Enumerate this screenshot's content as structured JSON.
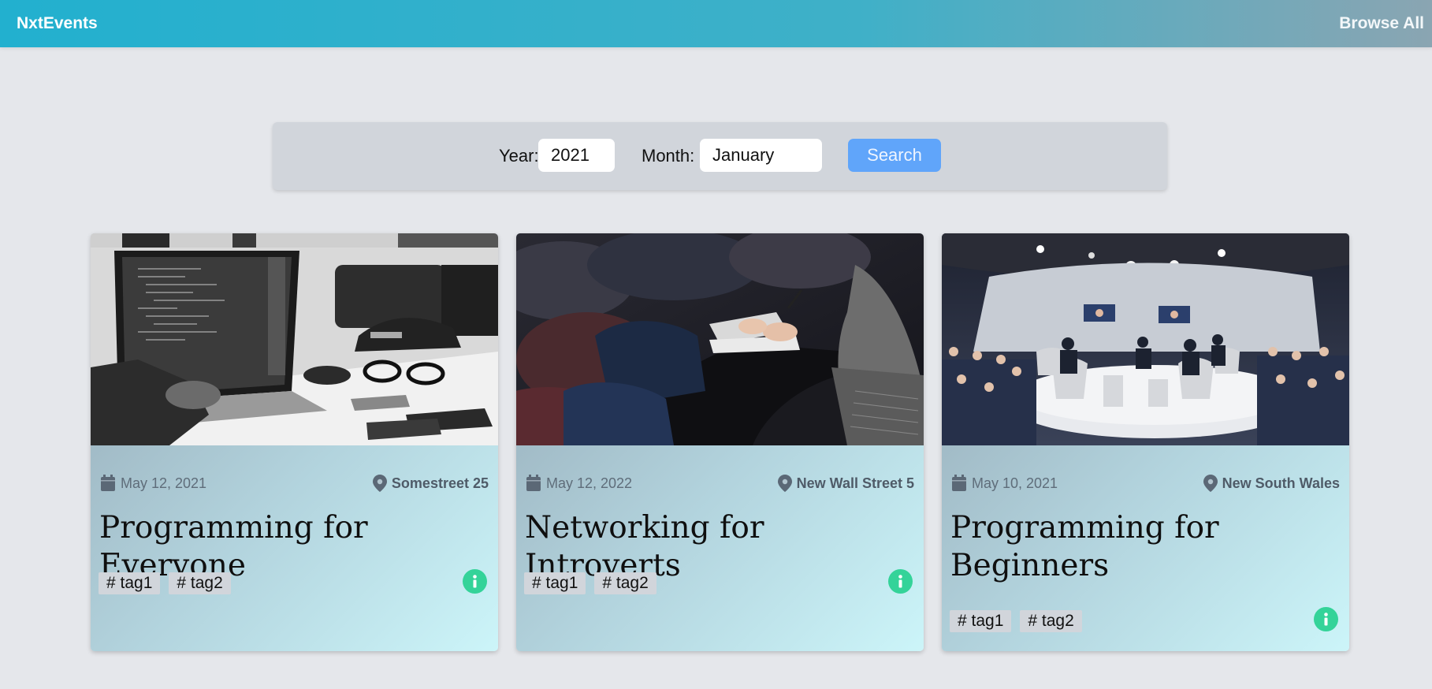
{
  "nav": {
    "brand": "NxtEvents",
    "browse_all": "Browse All"
  },
  "search": {
    "year_label": "Year:",
    "year_value": "2021",
    "month_label": "Month:",
    "month_value": "January",
    "button_label": "Search"
  },
  "colors": {
    "accent": "#60a5fa",
    "info": "#34d399",
    "header_start": "#22b0cf",
    "card_gradient_end": "#ccf5f9"
  },
  "events": [
    {
      "date": "May 12, 2021",
      "location": "Somestreet 25",
      "title": "Programming for Everyone",
      "tags": [
        "# tag1",
        "# tag2"
      ],
      "image": "laptop-desk-photo"
    },
    {
      "date": "May 12, 2022",
      "location": "New Wall Street 5",
      "title": "Networking for Introverts",
      "tags": [
        "# tag1",
        "# tag2"
      ],
      "image": "audience-taking-notes-photo"
    },
    {
      "date": "May 10, 2021",
      "location": "New South Wales",
      "title": "Programming for Beginners",
      "tags": [
        "# tag1",
        "# tag2"
      ],
      "image": "panel-discussion-stage-photo"
    }
  ]
}
